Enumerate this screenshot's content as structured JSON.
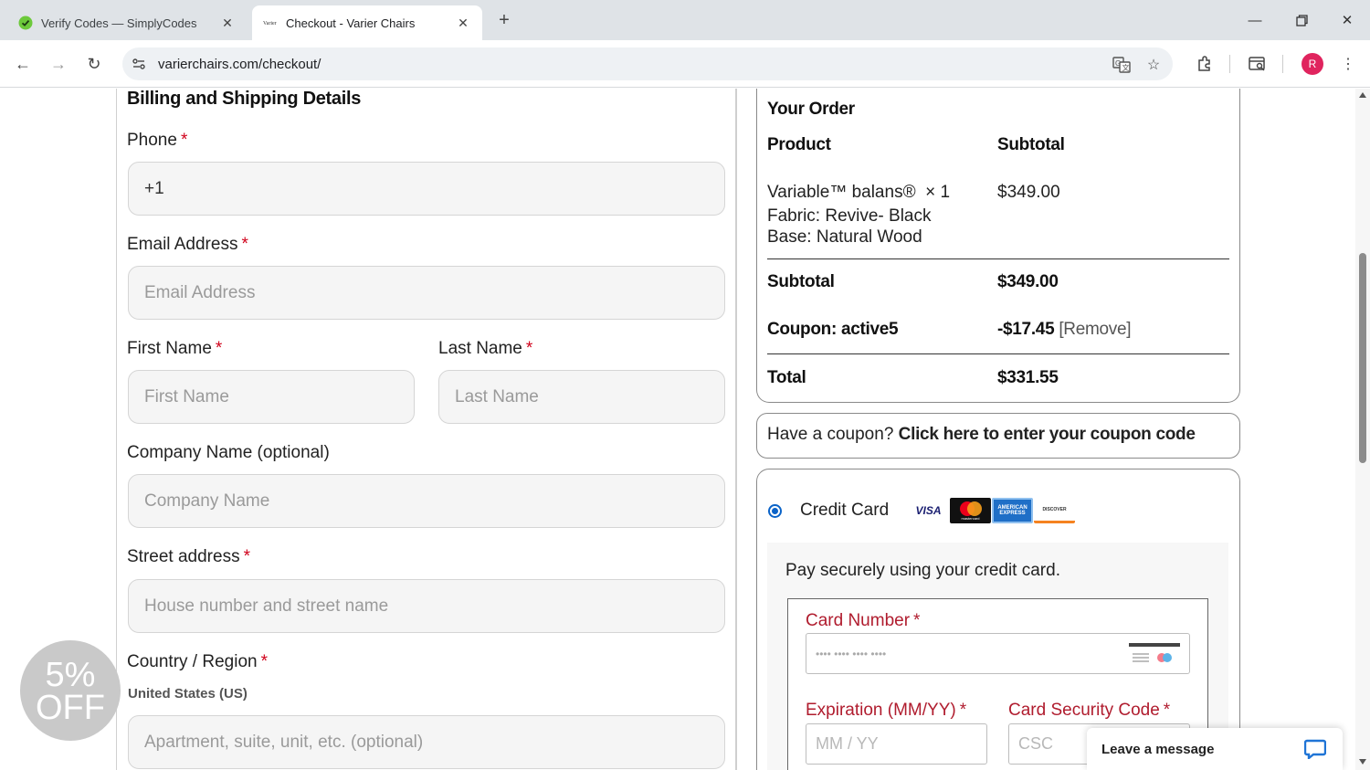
{
  "browser": {
    "tabs": [
      {
        "label": "Verify Codes — SimplyCodes",
        "active": false,
        "favicon": "simplycodes-check-icon"
      },
      {
        "label": "Checkout - Varier Chairs",
        "active": true,
        "favicon": "varier-logo-icon"
      }
    ],
    "new_tab_symbol": "+",
    "url": "varierchairs.com/checkout/",
    "profile_initial": "R"
  },
  "billing": {
    "title": "Billing and Shipping Details",
    "required_marker": "*",
    "phone": {
      "label": "Phone",
      "value": "+1"
    },
    "email": {
      "label": "Email Address",
      "placeholder": "Email Address"
    },
    "first_name": {
      "label": "First Name",
      "placeholder": "First Name"
    },
    "last_name": {
      "label": "Last Name",
      "placeholder": "Last Name"
    },
    "company": {
      "label": "Company Name (optional)",
      "placeholder": "Company Name"
    },
    "street": {
      "label": "Street address",
      "placeholder": "House number and street name"
    },
    "country": {
      "label": "Country / Region",
      "value": "United States (US)"
    },
    "apartment": {
      "placeholder": "Apartment, suite, unit, etc. (optional)"
    }
  },
  "promo": {
    "line1": "5%",
    "line2": "OFF"
  },
  "order": {
    "title": "Your Order",
    "col_product": "Product",
    "col_subtotal": "Subtotal",
    "item": {
      "name": "Variable™ balans®",
      "qty": "× 1",
      "fabric": "Fabric: Revive- Black",
      "base": "Base: Natural Wood",
      "price": "$349.00"
    },
    "subtotal_label": "Subtotal",
    "subtotal_value": "$349.00",
    "coupon_label": "Coupon: active5",
    "coupon_value": "-$17.45",
    "coupon_remove": "[Remove]",
    "total_label": "Total",
    "total_value": "$331.55"
  },
  "coupon_prompt": {
    "text": "Have a coupon?",
    "link": "Click here to enter your coupon code"
  },
  "payment": {
    "method_label": "Credit Card",
    "card_logos": [
      "VISA",
      "mastercard",
      "AMERICAN EXPRESS",
      "DISCOVER"
    ],
    "description": "Pay securely using your credit card.",
    "card_number": {
      "label": "Card Number",
      "placeholder": "•••• •••• •••• ••••"
    },
    "expiration": {
      "label": "Expiration (MM/YY)",
      "placeholder": "MM / YY"
    },
    "csc": {
      "label": "Card Security Code",
      "placeholder": "CSC"
    },
    "required_marker": "*"
  },
  "chat": {
    "label": "Leave a message"
  },
  "colors": {
    "required": "#d0021b",
    "card_label": "#b01c2e",
    "radio": "#0a63c8",
    "profile": "#e0245e",
    "chat_icon": "#1f74d6"
  }
}
